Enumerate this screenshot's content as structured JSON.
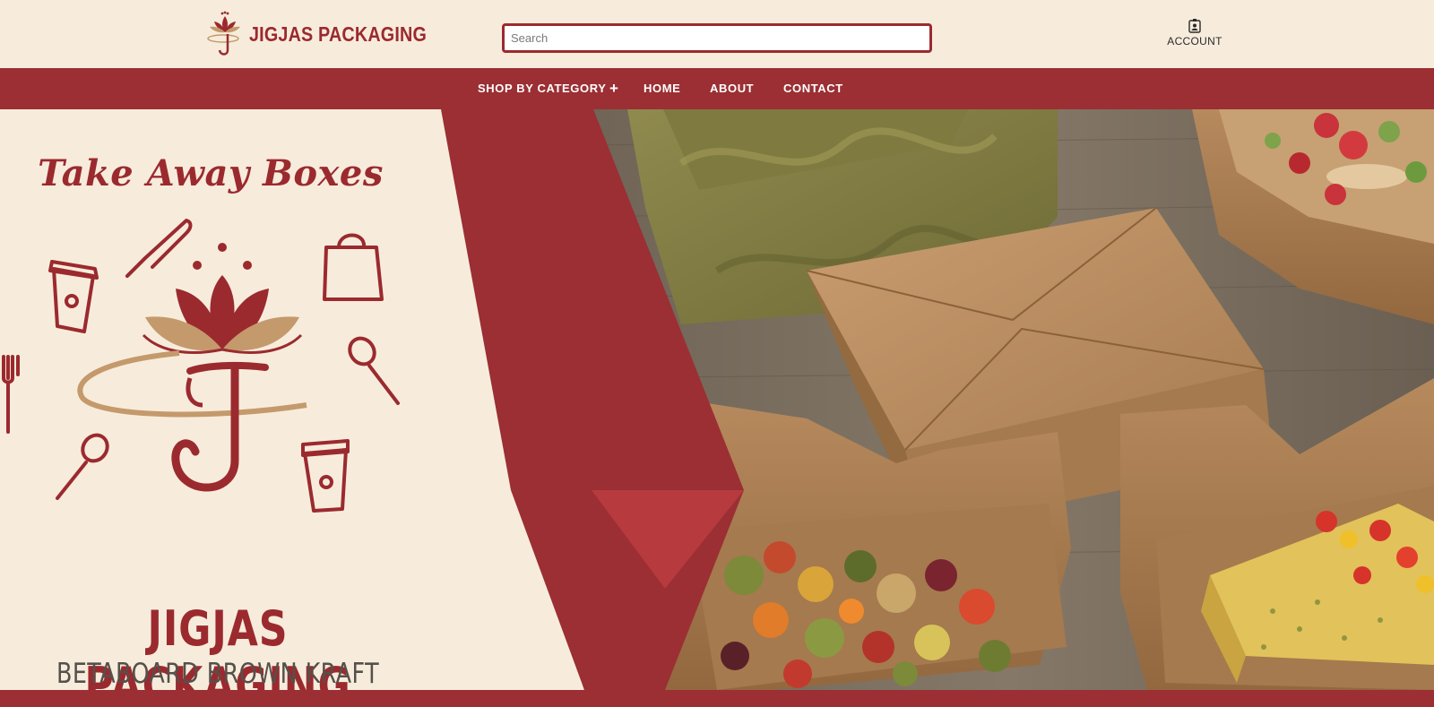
{
  "header": {
    "brand": "JIGJAS PACKAGING",
    "search": {
      "placeholder": "Search",
      "value": ""
    },
    "account_label": "ACCOUNT"
  },
  "nav": {
    "items": [
      {
        "label": "SHOP BY CATEGORY"
      },
      {
        "label": "HOME"
      },
      {
        "label": "ABOUT"
      },
      {
        "label": "CONTACT"
      }
    ],
    "expand_icon": "plus-icon"
  },
  "hero": {
    "script_title": "Take Away Boxes",
    "brand_title": "JIGJAS PACKAGING",
    "subtitle": "BETABOARD BROWN KRAFT BOXES",
    "icons": [
      "coffee-cup-icon",
      "knife-icon",
      "shopping-bag-icon",
      "spoon-icon",
      "fork-icon",
      "lotus-j-logo"
    ]
  },
  "colors": {
    "brand_red": "#9b2f33",
    "cream": "#f7ecdc",
    "gold": "#c49a6c",
    "kraft": "#b98b5e"
  }
}
